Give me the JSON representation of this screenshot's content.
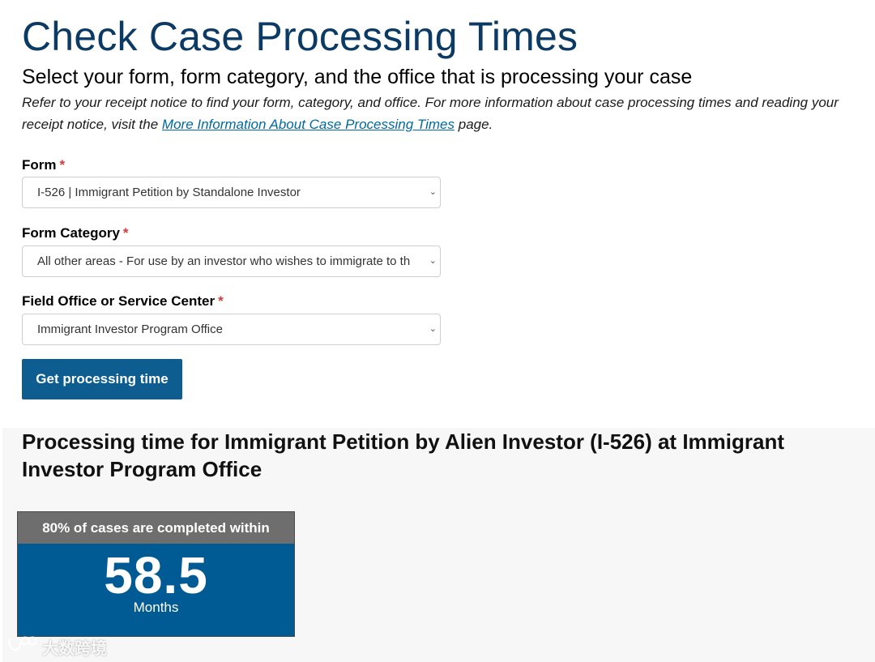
{
  "header": {
    "title": "Check Case Processing Times",
    "subtitle": "Select your form, form category, and the office that is processing your case",
    "intro_text": "Refer to your receipt notice to find your form, category, and office. For more information about case processing times and reading your receipt notice, visit the ",
    "intro_link": "More Information About Case Processing Times",
    "intro_suffix": " page."
  },
  "form": {
    "required_mark": "*",
    "chevron_icon": "chevron-down-icon",
    "form_field": {
      "label": "Form",
      "value": "I-526 | Immigrant Petition by Standalone Investor"
    },
    "category_field": {
      "label": "Form Category",
      "value": "All other areas - For use by an investor who wishes to immigrate to th"
    },
    "office_field": {
      "label": "Field Office or Service Center",
      "value": "Immigrant Investor Program Office"
    },
    "submit_label": "Get processing time"
  },
  "result": {
    "title": "Processing time for Immigrant Petition by Alien Investor (I-526) at Immigrant Investor Program Office",
    "card_header": "80% of cases are completed within",
    "value": "58.5",
    "unit": "Months"
  },
  "watermark": {
    "text": "大数跨境"
  },
  "colors": {
    "title": "#0b3a64",
    "link": "#00699d",
    "button": "#0e5d91",
    "card": "#005b94",
    "card_header": "#6e6e6e",
    "required": "#d83933"
  }
}
